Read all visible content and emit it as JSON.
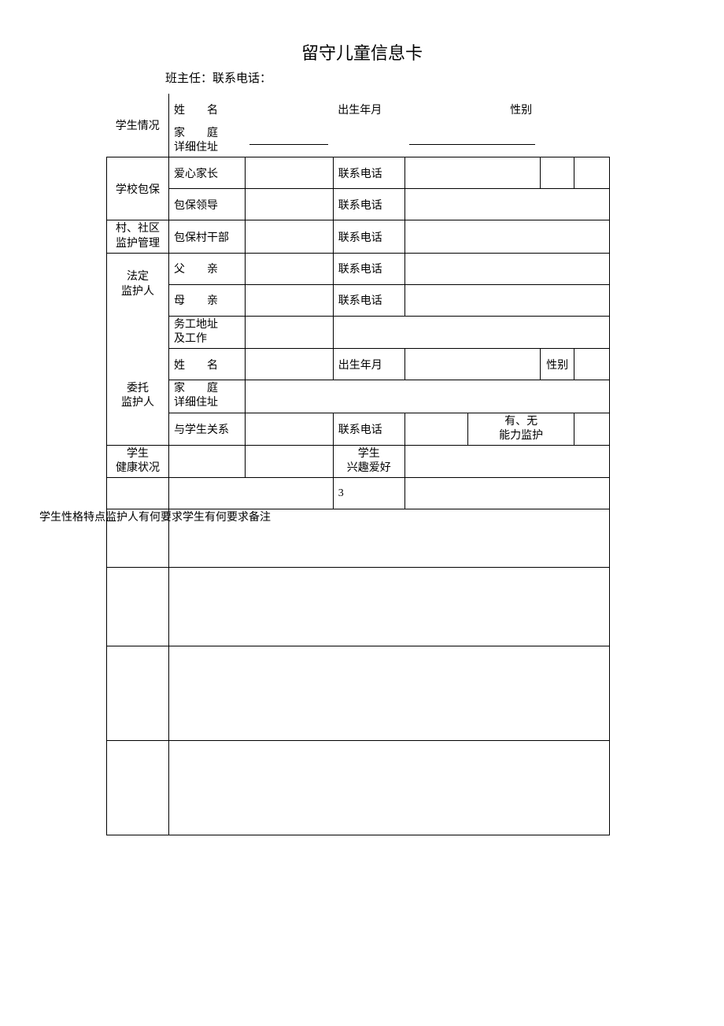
{
  "title": "留守儿童信息卡",
  "subtitle_prefix": "班主任：联系电话：",
  "sections": {
    "student": {
      "group": "学生情况",
      "name_label": "姓　　名",
      "dob_label": "出生年月",
      "gender_label": "性别",
      "addr_label_line1": "家　　庭",
      "addr_label_line2": "详细住址"
    },
    "school": {
      "group": "学校包保",
      "love_parent": "爱心家长",
      "leader": "包保领导",
      "contact": "联系电话"
    },
    "village": {
      "group_line1": "村、社区",
      "group_line2": "监护管理",
      "cadre": "包保村干部",
      "contact": "联系电话"
    },
    "legal": {
      "group_line1": "法定",
      "group_line2": "监护人",
      "father": "父　　亲",
      "mother": "母　　亲",
      "work_line1": "务工地址",
      "work_line2": "及工作",
      "contact": "联系电话"
    },
    "entrusted": {
      "group_line1": "委托",
      "group_line2": "监护人",
      "name_label": "姓　　名",
      "dob_label": "出生年月",
      "gender_label": "性别",
      "addr_label_line1": "家　　庭",
      "addr_label_line2": "详细住址",
      "relation": "与学生关系",
      "contact": "联系电话",
      "ability_line1": "有、无",
      "ability_line2": "能力监护"
    },
    "health": {
      "left_line1": "学生",
      "left_line2": "健康状况",
      "right_line1": "学生",
      "right_line2": "兴趣爱好"
    }
  },
  "extra_labels": "学生性格特点监护人有何要求学生有何要求备注",
  "stray_number": "3"
}
